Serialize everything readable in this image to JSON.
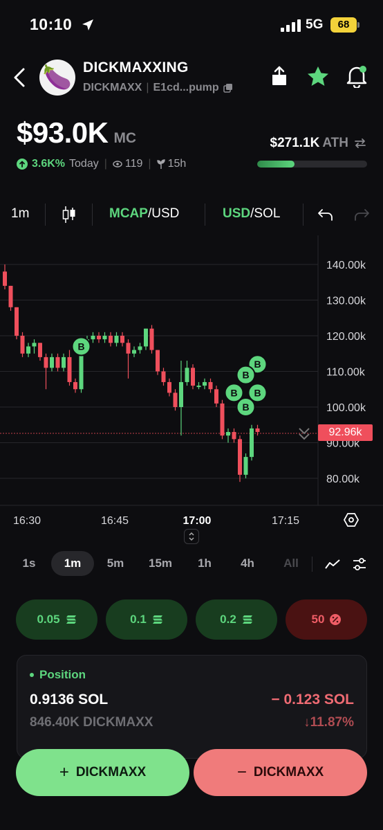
{
  "status": {
    "time": "10:10",
    "network": "5G",
    "battery": "68"
  },
  "token": {
    "name": "DICKMAXXING",
    "ticker": "DICKMAXX",
    "address": "E1cd...pump",
    "avatar_emoji": "🍆"
  },
  "market": {
    "mc_value": "$93.0K",
    "mc_unit": "MC",
    "change": "3.6K%",
    "change_period": "Today",
    "holders": "119",
    "age": "15h",
    "ath_value": "$271.1K",
    "ath_label": "ATH",
    "ath_progress": 0.34
  },
  "toolbar": {
    "interval": "1m",
    "mcap_label": "MCAP",
    "usd_label": "/USD",
    "usd2_label": "USD",
    "sol_label": "/SOL"
  },
  "chart_data": {
    "type": "candlestick",
    "y_ticks": [
      "140.00k",
      "130.00k",
      "120.00k",
      "110.00k",
      "100.00k",
      "90.00k",
      "80.00k"
    ],
    "x_ticks": [
      "16:30",
      "16:45",
      "17:00",
      "17:15"
    ],
    "current_price": "92.96k",
    "buy_marker_label": "B",
    "candles": [
      {
        "o": 138,
        "c": 134,
        "h": 140,
        "l": 133
      },
      {
        "o": 134,
        "c": 128,
        "h": 134,
        "l": 127
      },
      {
        "o": 128,
        "c": 120,
        "h": 128,
        "l": 119
      },
      {
        "o": 120,
        "c": 115,
        "h": 121,
        "l": 114
      },
      {
        "o": 115,
        "c": 117,
        "h": 118,
        "l": 114
      },
      {
        "o": 117,
        "c": 118,
        "h": 119,
        "l": 115
      },
      {
        "o": 118,
        "c": 114,
        "h": 118,
        "l": 113
      },
      {
        "o": 114,
        "c": 111,
        "h": 115,
        "l": 105
      },
      {
        "o": 111,
        "c": 114,
        "h": 115,
        "l": 110
      },
      {
        "o": 114,
        "c": 111,
        "h": 115,
        "l": 110
      },
      {
        "o": 111,
        "c": 114,
        "h": 115,
        "l": 110
      },
      {
        "o": 114,
        "c": 107,
        "h": 116,
        "l": 106
      },
      {
        "o": 107,
        "c": 105,
        "h": 108,
        "l": 104
      },
      {
        "o": 105,
        "c": 117,
        "h": 119,
        "l": 104
      },
      {
        "o": 117,
        "c": 119,
        "h": 120,
        "l": 116
      },
      {
        "o": 119,
        "c": 120,
        "h": 121,
        "l": 118
      },
      {
        "o": 120,
        "c": 119,
        "h": 121,
        "l": 118
      },
      {
        "o": 119,
        "c": 120,
        "h": 121,
        "l": 118
      },
      {
        "o": 120,
        "c": 118,
        "h": 121,
        "l": 117
      },
      {
        "o": 118,
        "c": 120,
        "h": 121,
        "l": 117
      },
      {
        "o": 120,
        "c": 118,
        "h": 121,
        "l": 117
      },
      {
        "o": 118,
        "c": 115,
        "h": 119,
        "l": 108
      },
      {
        "o": 115,
        "c": 116,
        "h": 117,
        "l": 114
      },
      {
        "o": 116,
        "c": 117,
        "h": 118,
        "l": 115
      },
      {
        "o": 117,
        "c": 122,
        "h": 122,
        "l": 116
      },
      {
        "o": 122,
        "c": 116,
        "h": 123,
        "l": 115
      },
      {
        "o": 116,
        "c": 110,
        "h": 116,
        "l": 109
      },
      {
        "o": 110,
        "c": 107,
        "h": 111,
        "l": 106
      },
      {
        "o": 107,
        "c": 104,
        "h": 108,
        "l": 103
      },
      {
        "o": 104,
        "c": 100,
        "h": 105,
        "l": 99
      },
      {
        "o": 100,
        "c": 107,
        "h": 113,
        "l": 92
      },
      {
        "o": 107,
        "c": 111,
        "h": 113,
        "l": 106
      },
      {
        "o": 111,
        "c": 106,
        "h": 112,
        "l": 105
      },
      {
        "o": 106,
        "c": 106,
        "h": 107,
        "l": 105
      },
      {
        "o": 106,
        "c": 107,
        "h": 108,
        "l": 105
      },
      {
        "o": 107,
        "c": 105,
        "h": 108,
        "l": 104
      },
      {
        "o": 105,
        "c": 101,
        "h": 106,
        "l": 100
      },
      {
        "o": 101,
        "c": 92,
        "h": 102,
        "l": 91
      },
      {
        "o": 92,
        "c": 93,
        "h": 94,
        "l": 90
      },
      {
        "o": 93,
        "c": 91,
        "h": 94,
        "l": 90
      },
      {
        "o": 91,
        "c": 81,
        "h": 92,
        "l": 79
      },
      {
        "o": 81,
        "c": 86,
        "h": 87,
        "l": 80
      },
      {
        "o": 86,
        "c": 94,
        "h": 95,
        "l": 85
      },
      {
        "o": 94,
        "c": 93,
        "h": 95,
        "l": 92
      }
    ],
    "buy_markers": [
      {
        "candle": 13,
        "price": 117
      },
      {
        "candle": 43,
        "price": 112
      },
      {
        "candle": 41,
        "price": 109
      },
      {
        "candle": 39,
        "price": 104
      },
      {
        "candle": 43,
        "price": 104
      },
      {
        "candle": 41,
        "price": 100
      }
    ]
  },
  "timeframes": [
    "1s",
    "1m",
    "5m",
    "15m",
    "1h",
    "4h",
    "All"
  ],
  "active_timeframe": "1m",
  "quick_buy": [
    {
      "label": "0.05",
      "type": "buy"
    },
    {
      "label": "0.1",
      "type": "buy"
    },
    {
      "label": "0.2",
      "type": "buy"
    },
    {
      "label": "50",
      "type": "sell"
    }
  ],
  "position": {
    "title": "Position",
    "sol_amount": "0.9136 SOL",
    "pnl_sol": "− 0.123 SOL",
    "token_amount": "846.40K DICKMAXX",
    "pnl_pct": "↓11.87%"
  },
  "actions": {
    "buy_label": "DICKMAXX",
    "sell_label": "DICKMAXX"
  },
  "colors": {
    "green": "#5dd67e",
    "red": "#ef4f5c",
    "bg": "#0d0d10"
  }
}
